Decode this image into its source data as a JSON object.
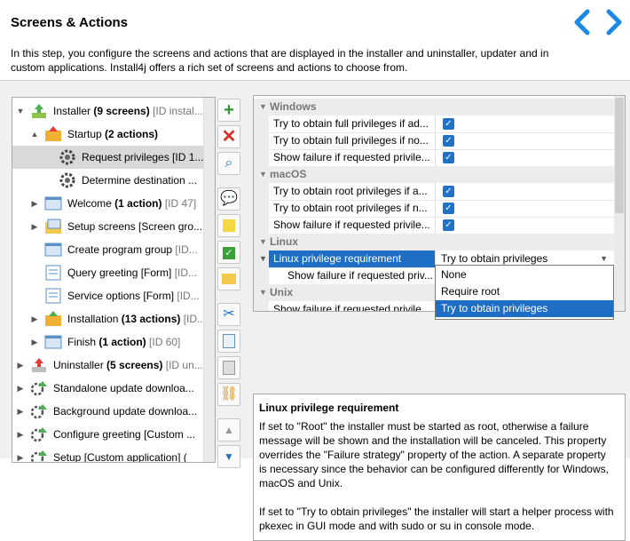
{
  "header": {
    "title": "Screens & Actions",
    "description": "In this step, you configure the screens and actions that are displayed in the installer and uninstaller, updater and in custom applications. Install4j offers a rich set of screens and actions to choose from.",
    "accent": "#1e88e5"
  },
  "tree": {
    "items": [
      {
        "label": "Installer ",
        "bold": "(9 screens)",
        "meta": " [ID instal...",
        "icon": "installer-icon",
        "arrow": "▼"
      },
      {
        "label": "Startup ",
        "bold": "(2 actions)",
        "meta": "",
        "icon": "startup-folder-icon",
        "arrow": "▲"
      },
      {
        "label": "Request privileges [ID 1...",
        "bold": "",
        "meta": "",
        "icon": "gear-icon",
        "arrow": ""
      },
      {
        "label": "Determine destination ...",
        "bold": "",
        "meta": "",
        "icon": "gear-icon",
        "arrow": ""
      },
      {
        "label": "Welcome ",
        "bold": "(1 action)",
        "meta": " [ID 47]",
        "icon": "screen-icon",
        "arrow": "▶"
      },
      {
        "label": "Setup screens [Screen gro...",
        "bold": "",
        "meta": "",
        "icon": "screen-group-icon",
        "arrow": "▶"
      },
      {
        "label": "Create program group ",
        "bold": "",
        "meta": "[ID...",
        "icon": "screen-icon",
        "arrow": ""
      },
      {
        "label": "Query greeting [Form] ",
        "bold": "",
        "meta": "[ID...",
        "icon": "form-icon",
        "arrow": ""
      },
      {
        "label": "Service options [Form] ",
        "bold": "",
        "meta": "[ID...",
        "icon": "form-icon",
        "arrow": ""
      },
      {
        "label": "Installation ",
        "bold": "(13 actions)",
        "meta": " [ID...",
        "icon": "installation-icon",
        "arrow": "▶"
      },
      {
        "label": "Finish ",
        "bold": "(1 action)",
        "meta": " [ID 60]",
        "icon": "screen-icon",
        "arrow": "▶"
      },
      {
        "label": "Uninstaller ",
        "bold": "(5 screens)",
        "meta": " [ID un...",
        "icon": "uninstaller-icon",
        "arrow": "▶"
      },
      {
        "label": "Standalone update downloa...",
        "bold": "",
        "meta": "",
        "icon": "updater-icon",
        "arrow": "▶"
      },
      {
        "label": "Background update downloa...",
        "bold": "",
        "meta": "",
        "icon": "updater-icon",
        "arrow": "▶"
      },
      {
        "label": "Configure greeting [Custom ...",
        "bold": "",
        "meta": "",
        "icon": "updater-icon",
        "arrow": "▶"
      },
      {
        "label": "Setup [Custom application] (",
        "bold": "",
        "meta": "",
        "icon": "updater-icon",
        "arrow": "▶"
      }
    ]
  },
  "toolbar": {
    "buttons": [
      "add-icon",
      "delete-icon",
      "search-icon",
      "comment-icon",
      "note-icon",
      "check-icon",
      "folder-icon",
      "cut-icon",
      "copy-icon",
      "paste-icon",
      "link-icon",
      "move-up-icon",
      "move-down-icon"
    ]
  },
  "props": {
    "windows": "Windows",
    "win1": "Try to obtain full privileges if ad...",
    "win2": "Try to obtain full privileges if no...",
    "win3": "Show failure if requested privile...",
    "macos": "macOS",
    "mac1": "Try to obtain root privileges if a...",
    "mac2": "Try to obtain root privileges if n...",
    "mac3": "Show failure if requested privile...",
    "linux": "Linux",
    "lin1": "Linux privilege requirement",
    "lin1_value": "Try to obtain privileges",
    "lin2": "Show failure if requested priv...",
    "unix": "Unix",
    "unix1": "Show failure if requested privile..."
  },
  "dropdown": {
    "options": [
      "None",
      "Require root",
      "Try to obtain privileges"
    ],
    "selected": "Try to obtain privileges"
  },
  "help": {
    "title": "Linux privilege requirement",
    "p1": "If set to \"Root\" the installer must be started as root, otherwise a failure message will be shown and the installation will be canceled. This property overrides the \"Failure strategy\" property of the action. A separate property is necessary since the behavior can be configured differently for Windows, macOS and Unix.",
    "p2": "If set to \"Try to obtain privileges\" the installer will start a helper process with pkexec in GUI mode and with sudo or su in console mode."
  }
}
